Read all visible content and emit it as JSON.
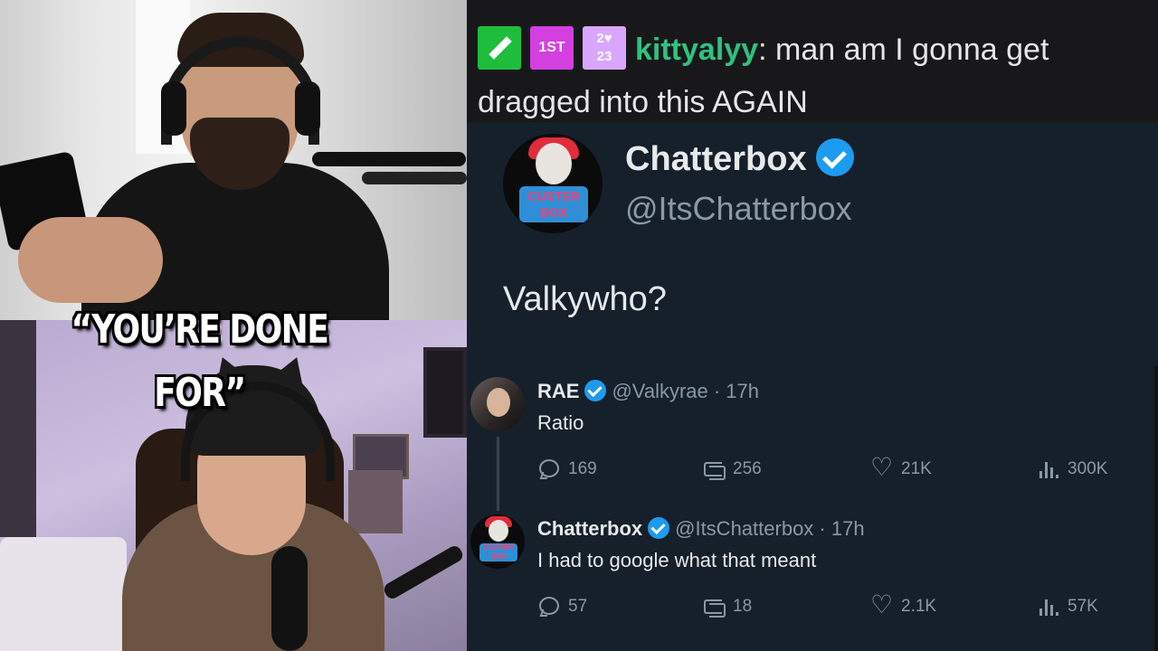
{
  "caption": "“YOU’RE DONE FOR”",
  "chat": {
    "badges": [
      "moderator-badge",
      "first-chatter-badge",
      "subscriber-badge"
    ],
    "first_badge_text": "1ST",
    "sub_badge_text": "2♥\n23",
    "username": "kittyalyy",
    "separator": ":",
    "message_line1": "man am I gonna get",
    "message_line2": "dragged into this AGAIN",
    "username_color": "#2ec27e"
  },
  "tweet": {
    "author_name": "Chatterbox",
    "author_handle": "@ItsChatterbox",
    "avatar_sign": "CUSTER BOX",
    "text": "Valkywho?",
    "accent_color": "#1d9bf0",
    "background_color": "#15202b"
  },
  "replies": [
    {
      "name": "RAE",
      "meta": "@Valkyrae · 17h",
      "text": "Ratio",
      "replies": "169",
      "retweets": "256",
      "likes": "21K",
      "views": "300K"
    },
    {
      "name": "Chatterbox",
      "meta": "@ItsChatterbox · 17h",
      "text": "I had to google what that meant",
      "avatar_sign": "CUSTER BOX",
      "replies": "57",
      "retweets": "18",
      "likes": "2.1K",
      "views": "57K"
    }
  ]
}
